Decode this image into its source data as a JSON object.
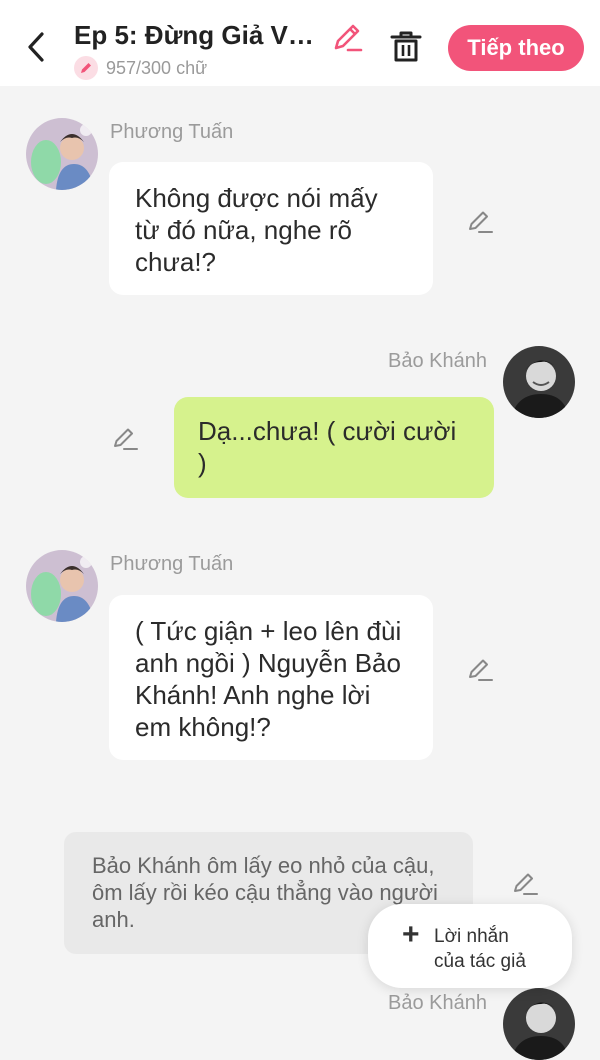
{
  "header": {
    "title": "Ep 5: Đừng Giả Vờ ...",
    "word_count": "957/300 chữ",
    "next_label": "Tiếp theo",
    "accent_color": "#f2547a"
  },
  "messages": [
    {
      "sender": "Phương Tuấn",
      "side": "left",
      "text": "Không được nói mấy từ đó nữa, nghe rõ chưa!?"
    },
    {
      "sender": "Bảo Khánh",
      "side": "right",
      "text": "Dạ...chưa! ( cười cười )"
    },
    {
      "sender": "Phương Tuấn",
      "side": "left",
      "text": "( Tức giận + leo lên đùi anh ngồi ) Nguyễn Bảo Khánh! Anh nghe lời em không!?"
    },
    {
      "type": "narration",
      "text": "Bảo Khánh ôm lấy eo nhỏ của cậu, ôm lấy rồi kéo cậu thẳng vào người anh."
    },
    {
      "sender": "Bảo Khánh",
      "side": "right",
      "text": ""
    }
  ],
  "author_note_button": {
    "icon": "plus-icon",
    "line1": "Lời nhắn",
    "line2": "của tác giả"
  },
  "colors": {
    "left_bubble": "#ffffff",
    "right_bubble": "#d6f28d",
    "narration_bubble": "#e9e9e9",
    "background": "#f4f4f4"
  }
}
